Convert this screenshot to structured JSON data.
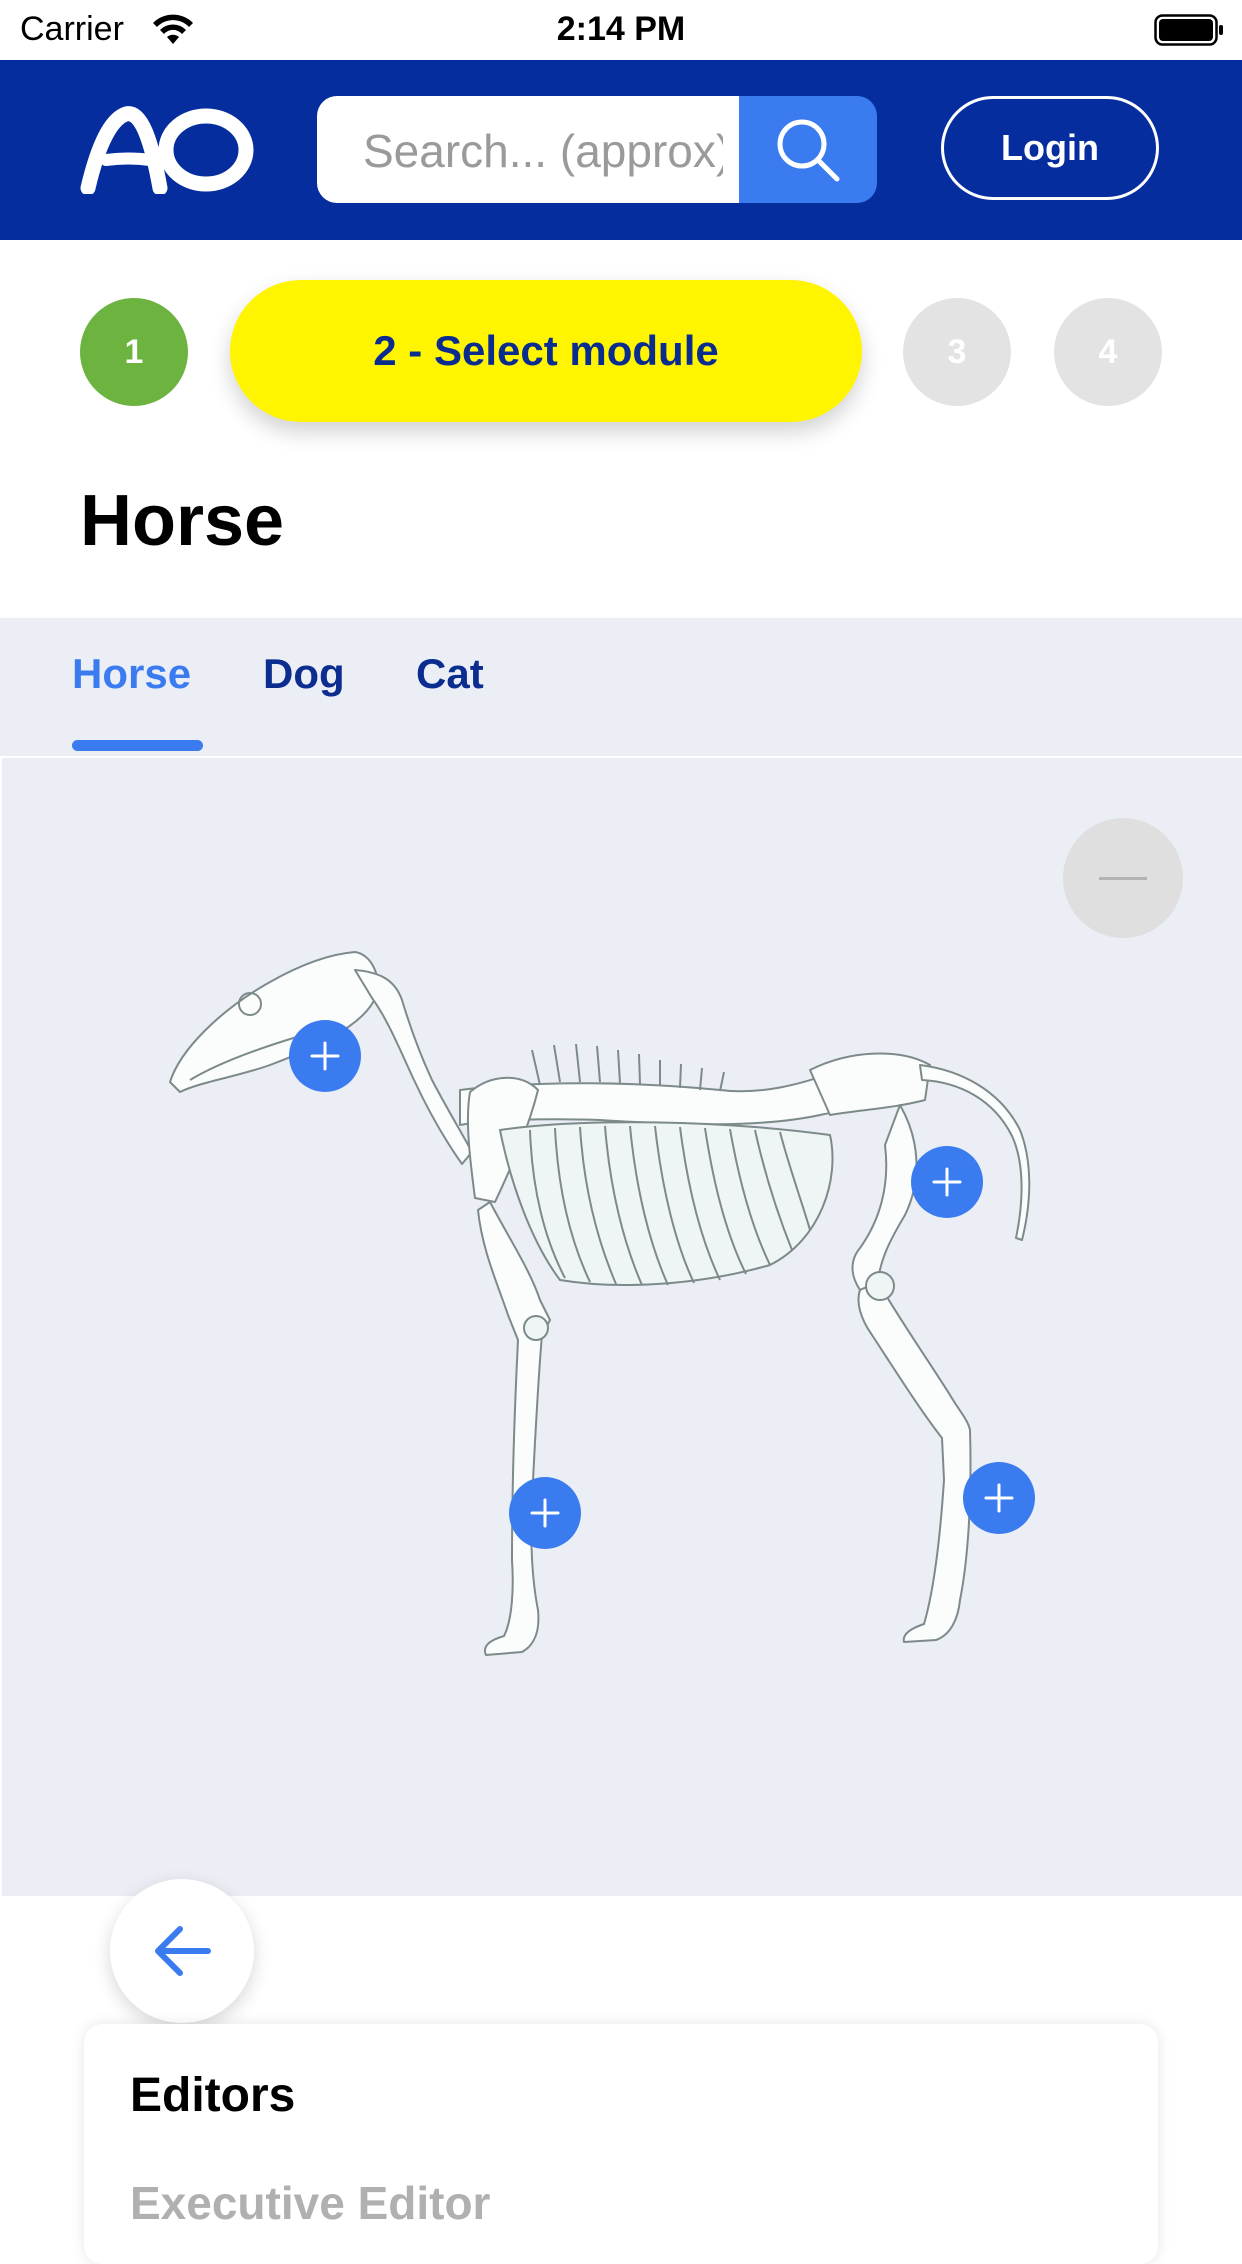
{
  "status_bar": {
    "carrier": "Carrier",
    "time": "2:14 PM"
  },
  "header": {
    "logo_text": "AO",
    "search_placeholder": "Search... (approx)",
    "login_label": "Login",
    "brand_color": "#062d9e",
    "accent_color": "#3a7cf0"
  },
  "steps": [
    {
      "label": "1",
      "state": "done"
    },
    {
      "label": "2 - Select module",
      "state": "active"
    },
    {
      "label": "3",
      "state": "todo"
    },
    {
      "label": "4",
      "state": "todo"
    }
  ],
  "page_title": "Horse",
  "tabs": [
    {
      "label": "Horse",
      "active": true
    },
    {
      "label": "Dog",
      "active": false
    },
    {
      "label": "Cat",
      "active": false
    }
  ],
  "canvas": {
    "image": "horse-skeleton",
    "hotspot_icon": "plus-icon",
    "zoom_icon": "minus-icon"
  },
  "editors": {
    "title": "Editors",
    "first_role": "Executive Editor"
  }
}
